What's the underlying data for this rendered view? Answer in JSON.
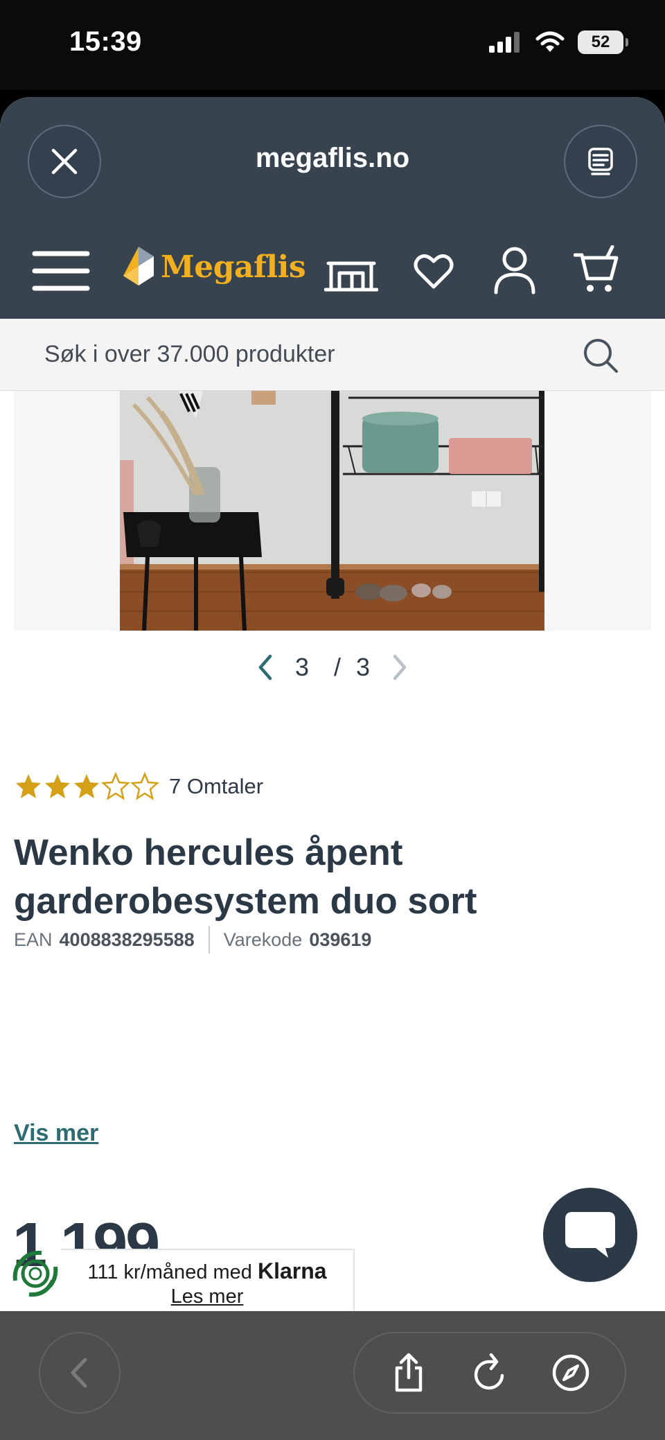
{
  "status_bar": {
    "time": "15:39",
    "battery": "52"
  },
  "browser": {
    "domain": "megaflis.no"
  },
  "site": {
    "brand": "Megaflis",
    "search_placeholder": "Søk i over 37.000 produkter",
    "accent_color": "#f2b01e",
    "header_color": "#37434f"
  },
  "gallery": {
    "current": "3",
    "separator": "/",
    "total": "3"
  },
  "product": {
    "rating_value": 3.5,
    "rating_max": 5,
    "reviews_label": "7 Omtaler",
    "title": "Wenko hercules åpent garderobesystem duo sort",
    "ean_label": "EAN",
    "ean": "4008838295588",
    "sku_label": "Varekode",
    "sku": "039619",
    "show_more": "Vis mer",
    "price": "1 199"
  },
  "klarna": {
    "text": "111 kr/måned med",
    "brand": "Klarna",
    "link": "Les mer"
  },
  "icons": {
    "close": "close-icon",
    "reader": "reader-view-icon",
    "menu": "hamburger-menu-icon",
    "store": "store-icon",
    "wishlist": "heart-icon",
    "account": "user-icon",
    "cart": "cart-icon",
    "search": "search-icon",
    "chat": "chat-bubble-icon",
    "back": "chevron-left-icon",
    "share": "share-icon",
    "reload": "reload-icon",
    "compass": "compass-icon"
  }
}
